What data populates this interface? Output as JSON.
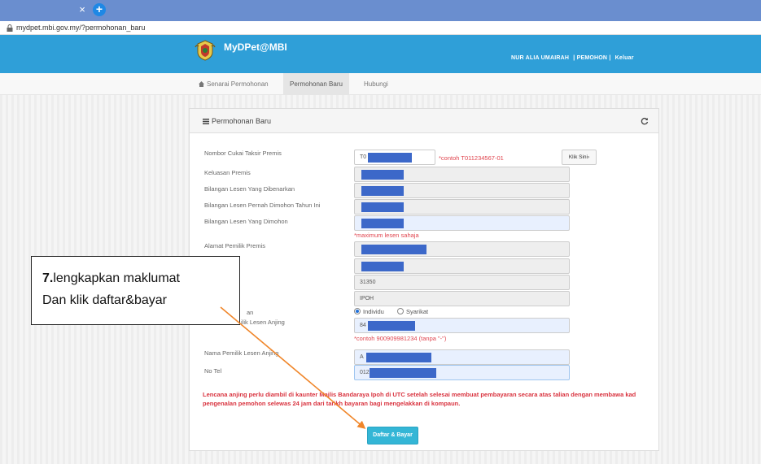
{
  "browser": {
    "close_glyph": "×",
    "new_tab_glyph": "+",
    "url": "mydpet.mbi.gov.my/?permohonan_baru"
  },
  "header": {
    "title": "MyDPet@MBI",
    "user_name": "NUR ALIA UMAIRAH",
    "role": "PEMOHON",
    "logout": "Keluar",
    "separator": "|"
  },
  "nav": {
    "items": [
      "Senarai Permohonan",
      "Permohonan Baru",
      "Hubungi"
    ],
    "active": "Permohonan Baru"
  },
  "panel": {
    "title": "Permohonan Baru",
    "fields": {
      "cukai_label": "Nombor Cukai Taksir Premis",
      "cukai_value": "T0",
      "cukai_hint": "*contoh T011234567-01",
      "klik_button": "Klik Sini",
      "keluasan_label": "Keluasan Premis",
      "dibenarkan_label": "Bilangan Lesen Yang Dibenarkan",
      "pernah_label": "Bilangan Lesen Pernah Dimohon Tahun Ini",
      "dimohon_label": "Bilangan Lesen Yang Dimohon",
      "dimohon_hint": "*maximum lesen sahaja",
      "alamat_label": "Alamat Pemilik Premis",
      "poskod_value": "31350",
      "bandar_value": "IPOH",
      "jenis_label_tail": "an",
      "radio_individu": "Individu",
      "radio_syarikat": "Syarikat",
      "ic_label_tail": "ilik Lesen Anjing",
      "ic_value": "84",
      "ic_hint": "*contoh 900909981234 (tanpa \"-\")",
      "nama_label": "Nama Pemilik Lesen Anjing",
      "nama_value": "A",
      "tel_label": "No Tel",
      "tel_value": "012"
    },
    "notice": "Lencana anjing perlu diambil di kaunter Majlis Bandaraya Ipoh di UTC setelah selesai membuat pembayaran secara atas talian dengan membawa kad pengenalan pemohon selewas 24 jam dari tarikh bayaran bagi mengelakkan di kompaun.",
    "submit_button": "Daftar & Bayar"
  },
  "callout": {
    "step": "7.",
    "line1": "lengkapkan maklumat",
    "line2": "Dan klik daftar&bayar"
  },
  "colors": {
    "header_bg": "#2f9fd8",
    "redaction": "#3c68c9",
    "hint_red": "#e0454f",
    "submit_bg": "#34b6d6",
    "arrow": "#f0862a"
  }
}
